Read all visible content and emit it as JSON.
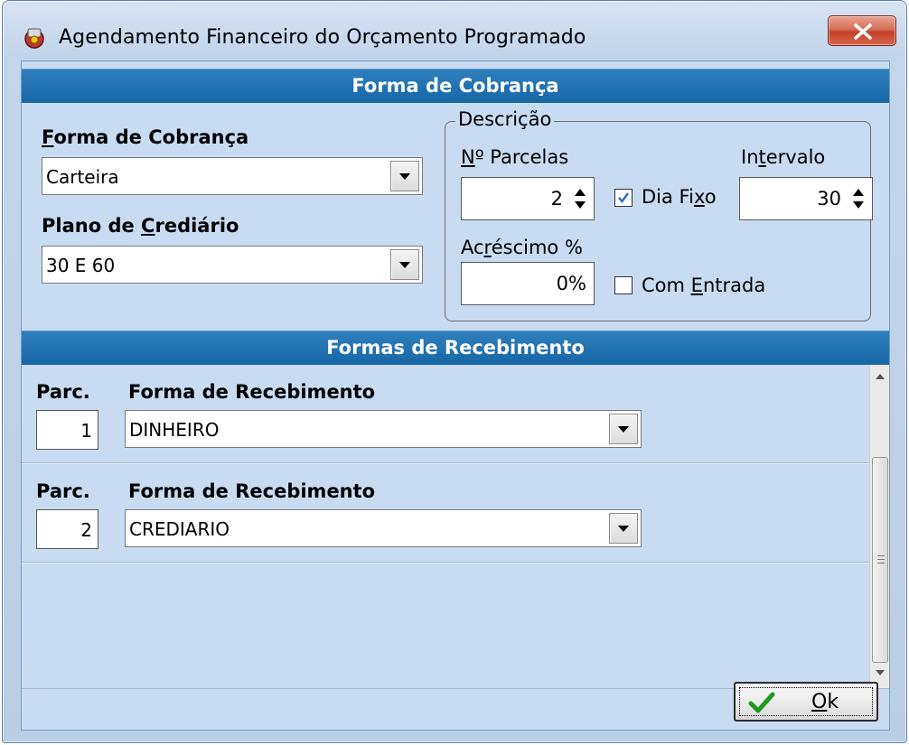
{
  "window": {
    "title": "Agendamento Financeiro do Orçamento Programado"
  },
  "forma_cobranca_section": {
    "header": "Forma de Cobrança",
    "forma_cobranca": {
      "label_first": "F",
      "label_rest": "orma de Cobrança",
      "value": "Carteira"
    },
    "plano_crediario": {
      "label_before": "Plano de ",
      "label_accel": "C",
      "label_after": "rediário",
      "value": "30 E 60"
    },
    "descricao": {
      "title": "Descrição",
      "parcelas": {
        "label_accel": "N",
        "label_rest": "º Parcelas",
        "value": "2"
      },
      "intervalo": {
        "label_before": "In",
        "label_accel": "t",
        "label_after": "ervalo",
        "value": "30"
      },
      "dia_fixo": {
        "label_before": "Dia Fi",
        "label_accel": "x",
        "label_after": "o",
        "checked": true
      },
      "acrescimo": {
        "label_before": "Ac",
        "label_accel": "r",
        "label_after": "éscimo %",
        "value": "0%"
      },
      "com_entrada": {
        "label_before": "Com ",
        "label_accel": "E",
        "label_after": "ntrada",
        "checked": false
      }
    }
  },
  "formas_recebimento_section": {
    "header": "Formas de Recebimento",
    "rows": [
      {
        "parc_label": "Parc.",
        "forma_label": "Forma de Recebimento",
        "parc": "1",
        "forma": "DINHEIRO"
      },
      {
        "parc_label": "Parc.",
        "forma_label": "Forma de Recebimento",
        "parc": "2",
        "forma": "CREDIARIO"
      }
    ]
  },
  "footer": {
    "ok_accel": "O",
    "ok_rest": "k"
  },
  "colors": {
    "section_header": "#1766a6",
    "client_bg": "#c9dbf1",
    "check_blue": "#2a6fb0",
    "ok_green": "#1e9a20"
  }
}
